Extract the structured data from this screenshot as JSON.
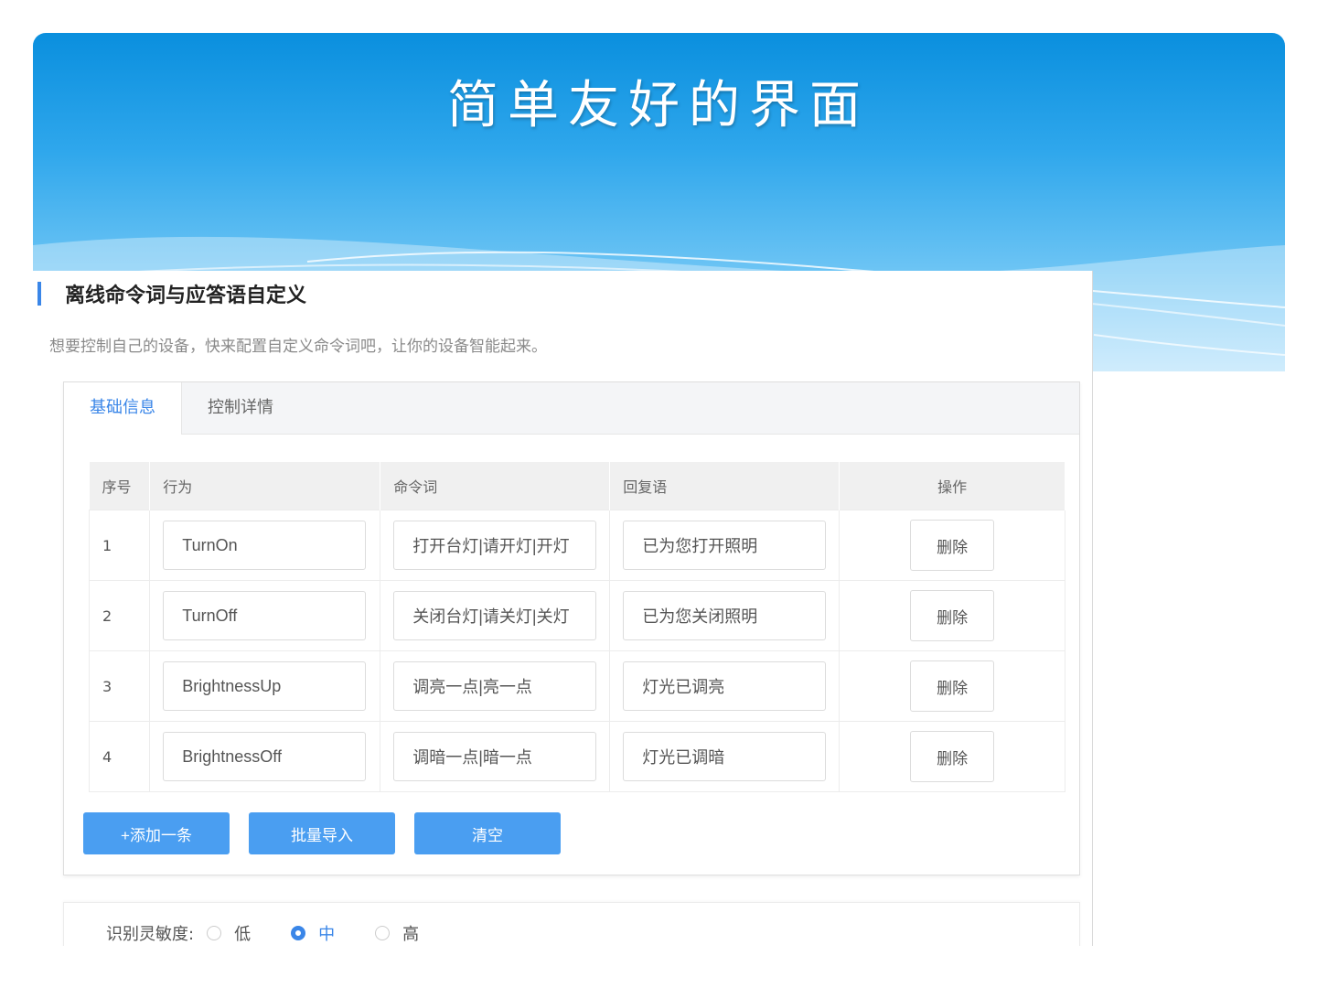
{
  "slide": {
    "title": "简单友好的界面"
  },
  "section": {
    "title": "离线命令词与应答语自定义",
    "description": "想要控制自己的设备，快来配置自定义命令词吧，让你的设备智能起来。"
  },
  "tabs": [
    {
      "label": "基础信息",
      "active": true
    },
    {
      "label": "控制详情",
      "active": false
    }
  ],
  "table": {
    "headers": [
      "序号",
      "行为",
      "命令词",
      "回复语",
      "操作"
    ],
    "rows": [
      {
        "index": "1",
        "action": "TurnOn",
        "command": "打开台灯|请开灯|开灯",
        "reply": "已为您打开照明",
        "op": "删除"
      },
      {
        "index": "2",
        "action": "TurnOff",
        "command": "关闭台灯|请关灯|关灯",
        "reply": "已为您关闭照明",
        "op": "删除"
      },
      {
        "index": "3",
        "action": "BrightnessUp",
        "command": "调亮一点|亮一点",
        "reply": "灯光已调亮",
        "op": "删除"
      },
      {
        "index": "4",
        "action": "BrightnessOff",
        "command": "调暗一点|暗一点",
        "reply": "灯光已调暗",
        "op": "删除"
      }
    ]
  },
  "buttons": {
    "add": "+添加一条",
    "import": "批量导入",
    "clear": "清空"
  },
  "sensitivity": {
    "label": "识别灵敏度:",
    "options": [
      {
        "label": "低",
        "checked": false
      },
      {
        "label": "中",
        "checked": true
      },
      {
        "label": "高",
        "checked": false
      }
    ]
  },
  "colors": {
    "accent": "#3a86e8",
    "button": "#4a9ef1",
    "banner": "#0a8fde"
  }
}
